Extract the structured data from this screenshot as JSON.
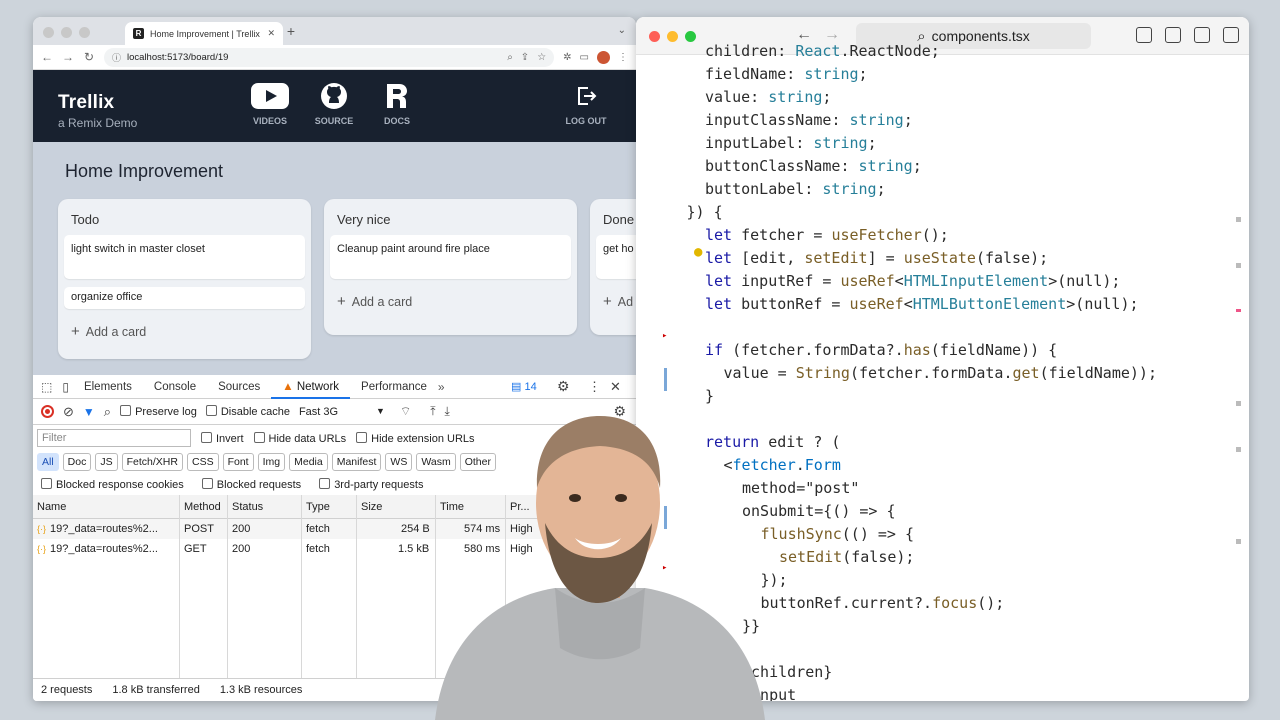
{
  "browser": {
    "tab_title": "Home Improvement | Trellix",
    "url": "localhost:5173/board/19"
  },
  "trellix": {
    "brand": "Trellix",
    "subtitle": "a Remix Demo",
    "nav": [
      {
        "label": "VIDEOS",
        "icon": "youtube-icon"
      },
      {
        "label": "SOURCE",
        "icon": "github-icon"
      },
      {
        "label": "DOCS",
        "icon": "remix-icon"
      },
      {
        "label": "LOG OUT",
        "icon": "logout-icon"
      }
    ],
    "board_title": "Home Improvement",
    "columns": [
      {
        "title": "Todo",
        "cards": [
          "light switch in master closet",
          "organize office"
        ],
        "add": "Add a card"
      },
      {
        "title": "Very nice",
        "cards": [
          "Cleanup paint around fire place"
        ],
        "add": "Add a card"
      },
      {
        "title": "Done",
        "cards": [
          "get ho"
        ],
        "add": "Ad"
      }
    ]
  },
  "devtools": {
    "tabs": [
      "Elements",
      "Console",
      "Sources",
      "Network",
      "Performance"
    ],
    "active_tab": "Network",
    "issues_count": "14",
    "preserve_log": "Preserve log",
    "disable_cache": "Disable cache",
    "throttle": "Fast 3G",
    "filter_placeholder": "Filter",
    "invert": "Invert",
    "hide_data_urls": "Hide data URLs",
    "hide_extension_urls": "Hide extension URLs",
    "types": [
      "All",
      "Doc",
      "JS",
      "Fetch/XHR",
      "CSS",
      "Font",
      "Img",
      "Media",
      "Manifest",
      "WS",
      "Wasm",
      "Other"
    ],
    "blocked_cookies": "Blocked response cookies",
    "blocked_requests": "Blocked requests",
    "third_party": "3rd-party requests",
    "columns": [
      "Name",
      "Method",
      "Status",
      "Type",
      "Size",
      "Time",
      "Pr..."
    ],
    "rows": [
      {
        "name": "19?_data=routes%2...",
        "method": "POST",
        "status": "200",
        "type": "fetch",
        "size": "254 B",
        "time": "574 ms",
        "priority": "High"
      },
      {
        "name": "19?_data=routes%2...",
        "method": "GET",
        "status": "200",
        "type": "fetch",
        "size": "1.5 kB",
        "time": "580 ms",
        "priority": "High"
      }
    ],
    "status": [
      "2 requests",
      "1.8 kB transferred",
      "1.3 kB resources"
    ]
  },
  "editor": {
    "filename": "components.tsx",
    "code": [
      {
        "indent": 2,
        "text": "children: React.ReactNode;"
      },
      {
        "indent": 2,
        "text": "fieldName: string;"
      },
      {
        "indent": 2,
        "text": "value: string;"
      },
      {
        "indent": 2,
        "text": "inputClassName: string;"
      },
      {
        "indent": 2,
        "text": "inputLabel: string;"
      },
      {
        "indent": 2,
        "text": "buttonClassName: string;"
      },
      {
        "indent": 2,
        "text": "buttonLabel: string;"
      },
      {
        "indent": 1,
        "text": "}) {"
      },
      {
        "indent": 2,
        "text": "let fetcher = useFetcher();"
      },
      {
        "indent": 2,
        "text": "let [edit, setEdit] = useState(false);"
      },
      {
        "indent": 2,
        "text": "let inputRef = useRef<HTMLInputElement>(null);"
      },
      {
        "indent": 2,
        "text": "let buttonRef = useRef<HTMLButtonElement>(null);"
      },
      {
        "indent": 0,
        "text": ""
      },
      {
        "indent": 2,
        "text": "if (fetcher.formData?.has(fieldName)) {"
      },
      {
        "indent": 3,
        "text": "value = String(fetcher.formData.get(fieldName));"
      },
      {
        "indent": 2,
        "text": "}"
      },
      {
        "indent": 0,
        "text": ""
      },
      {
        "indent": 2,
        "text": "return edit ? ("
      },
      {
        "indent": 3,
        "text": "<fetcher.Form"
      },
      {
        "indent": 4,
        "text": "method=\"post\""
      },
      {
        "indent": 4,
        "text": "onSubmit={() => {"
      },
      {
        "indent": 5,
        "text": "flushSync(() => {"
      },
      {
        "indent": 6,
        "text": "setEdit(false);"
      },
      {
        "indent": 5,
        "text": "});"
      },
      {
        "indent": 5,
        "text": "buttonRef.current?.focus();"
      },
      {
        "indent": 4,
        "text": "}}"
      },
      {
        "indent": 0,
        "text": ""
      },
      {
        "indent": 4,
        "text": "{children}"
      },
      {
        "indent": 4,
        "text": "<input"
      }
    ]
  }
}
